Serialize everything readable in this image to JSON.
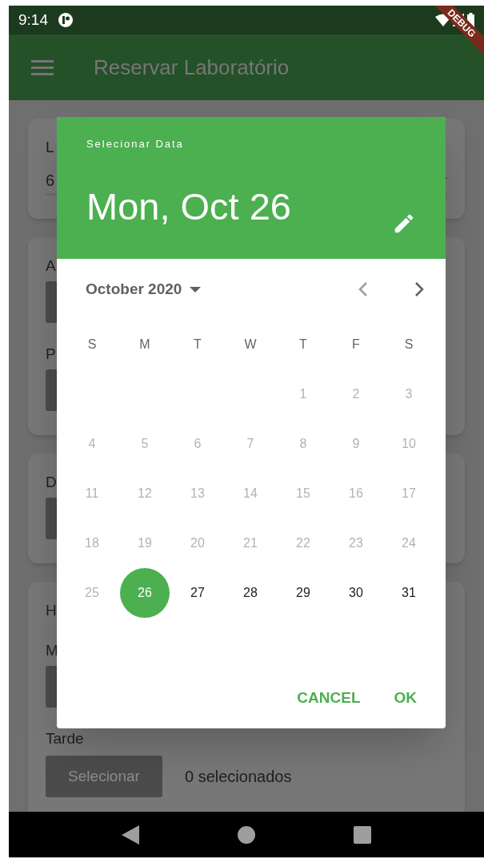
{
  "status_bar": {
    "time": "9:14"
  },
  "debug_banner": "DEBUG",
  "app_bar": {
    "title": "Reservar Laboratório"
  },
  "form_cards": [
    {
      "items": [
        {
          "kind": "label",
          "text": "L"
        },
        {
          "kind": "dropdown",
          "text": "6"
        }
      ]
    },
    {
      "items": [
        {
          "kind": "label",
          "text": "A"
        },
        {
          "kind": "button"
        },
        {
          "kind": "label",
          "text": "P"
        },
        {
          "kind": "button"
        }
      ]
    },
    {
      "items": [
        {
          "kind": "label",
          "text": "D"
        },
        {
          "kind": "button"
        }
      ]
    },
    {
      "items": [
        {
          "kind": "label",
          "text": "H"
        },
        {
          "kind": "label",
          "text": "M"
        },
        {
          "kind": "button"
        },
        {
          "kind": "label",
          "text": "Tarde"
        },
        {
          "kind": "button_row",
          "button": "Selecionar",
          "count": "0 selecionados"
        }
      ]
    }
  ],
  "date_picker": {
    "header_label": "Selecionar Data",
    "selected_date": "Mon, Oct 26",
    "month": "October 2020",
    "weekdays": [
      "S",
      "M",
      "T",
      "W",
      "T",
      "F",
      "S"
    ],
    "weeks": [
      {
        "partial": true,
        "days": [
          {
            "label": "1",
            "disabled": true,
            "selected": false
          },
          {
            "label": "2",
            "disabled": true,
            "selected": false
          },
          {
            "label": "3",
            "disabled": true,
            "selected": false
          }
        ]
      },
      {
        "partial": false,
        "days": [
          {
            "label": "4",
            "disabled": true,
            "selected": false
          },
          {
            "label": "5",
            "disabled": true,
            "selected": false
          },
          {
            "label": "6",
            "disabled": true,
            "selected": false
          },
          {
            "label": "7",
            "disabled": true,
            "selected": false
          },
          {
            "label": "8",
            "disabled": true,
            "selected": false
          },
          {
            "label": "9",
            "disabled": true,
            "selected": false
          },
          {
            "label": "10",
            "disabled": true,
            "selected": false
          }
        ]
      },
      {
        "partial": false,
        "days": [
          {
            "label": "11",
            "disabled": true,
            "selected": false
          },
          {
            "label": "12",
            "disabled": true,
            "selected": false
          },
          {
            "label": "13",
            "disabled": true,
            "selected": false
          },
          {
            "label": "14",
            "disabled": true,
            "selected": false
          },
          {
            "label": "15",
            "disabled": true,
            "selected": false
          },
          {
            "label": "16",
            "disabled": true,
            "selected": false
          },
          {
            "label": "17",
            "disabled": true,
            "selected": false
          }
        ]
      },
      {
        "partial": false,
        "days": [
          {
            "label": "18",
            "disabled": true,
            "selected": false
          },
          {
            "label": "19",
            "disabled": true,
            "selected": false
          },
          {
            "label": "20",
            "disabled": true,
            "selected": false
          },
          {
            "label": "21",
            "disabled": true,
            "selected": false
          },
          {
            "label": "22",
            "disabled": true,
            "selected": false
          },
          {
            "label": "23",
            "disabled": true,
            "selected": false
          },
          {
            "label": "24",
            "disabled": true,
            "selected": false
          }
        ]
      },
      {
        "partial": false,
        "days": [
          {
            "label": "25",
            "disabled": true,
            "selected": false
          },
          {
            "label": "26",
            "disabled": false,
            "selected": true
          },
          {
            "label": "27",
            "disabled": false,
            "selected": false
          },
          {
            "label": "28",
            "disabled": false,
            "selected": false
          },
          {
            "label": "29",
            "disabled": false,
            "selected": false
          },
          {
            "label": "30",
            "disabled": false,
            "selected": false
          },
          {
            "label": "31",
            "disabled": false,
            "selected": false
          }
        ]
      }
    ],
    "buttons": [
      "CANCEL",
      "OK"
    ]
  }
}
